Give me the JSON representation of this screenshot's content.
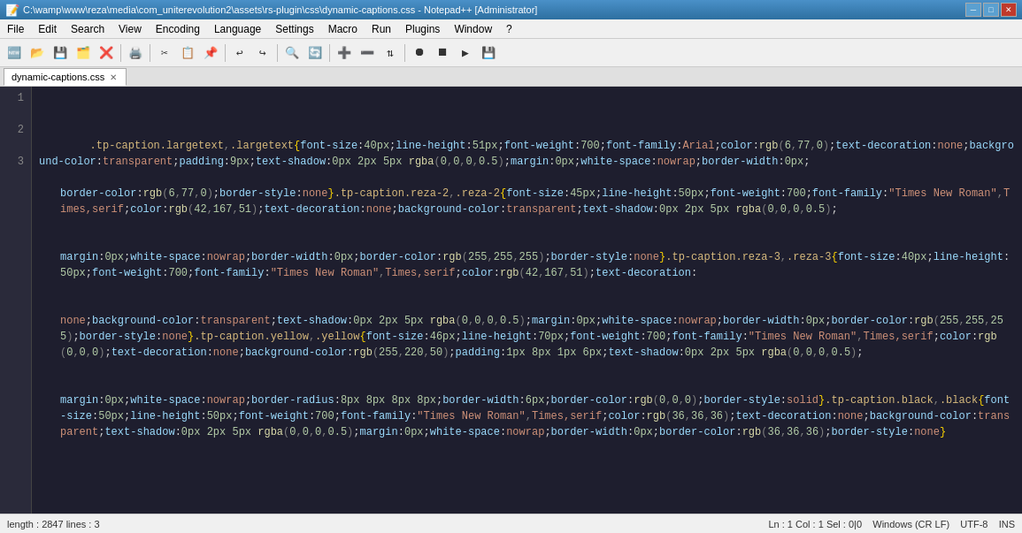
{
  "titleBar": {
    "icon": "📄",
    "title": "C:\\wamp\\www\\reza\\media\\com_uniterevolution2\\assets\\rs-plugin\\css\\dynamic-captions.css - Notepad++ [Administrator]",
    "minimize": "─",
    "maximize": "□",
    "close": "✕"
  },
  "menuBar": {
    "items": [
      "File",
      "Edit",
      "Search",
      "View",
      "Encoding",
      "Language",
      "Settings",
      "Macro",
      "Run",
      "Plugins",
      "Window",
      "?"
    ]
  },
  "tab": {
    "label": "dynamic-captions.css",
    "close": "✕"
  },
  "statusBar": {
    "left": "length: 2847  lines: 3",
    "right": "Ln: 1  Col: 1  Sel: 0|0"
  },
  "lineNumbers": [
    "1",
    "",
    "2",
    "",
    "3"
  ],
  "code": {
    "line1_full": ".tp-caption.largetext,.largetext{font-size:40px;line-height:51px;font-weight:700;font-family:Arial;color:rgb(6,77,0);text-decoration:none;background-color:transparent;padding:9px;text-shadow:0px 2px 5px rgba(0,0,0,0.5);margin:0px;white-space:nowrap;border-width:0px;border-color:rgb(6,77,0);border-style:none}.tp-caption.reza-2,.reza-2{font-size:45px;line-height:50px;font-weight:700;font-family:\"Times New Roman\",Times,serif;color:rgb(42,167,51);text-decoration:none;background-color:transparent;text-shadow:0px 2px 5px rgba(0,0,0,0.5);margin:0px;white-space:nowrap;border-width:0px;border-color:rgb(255,255,255);border-style:none}.tp-caption.reza-3,.reza-3{font-size:40px;line-height:50px;font-weight:700;font-family:\"Times New Roman\",Times,serif;color:rgb(42,167,51);text-decoration:none;background-color:transparent;text-shadow:0px 2px 5px rgba(0,0,0,0.5);margin:0px;white-space:nowrap;border-width:0px;border-color:rgb(255,255,255);border-style:none}.tp-caption.yellow,.yellow{font-size:46px;line-height:70px;font-weight:700;font-family:\"Times New Roman\",Times,serif;color:rgb(0,0,0);text-decoration:none;background-color:rgb(255,220,50);padding:1px 8px 1px 6px;text-shadow:0px 2px 5px rgba(0,0,0,0.5);margin:0px;white-space:nowrap;border-radius:8px 8px 8px 8px;border-width:6px;border-color:rgb(0,0,0);border-style:solid}.tp-caption.black,.black{font-size:50px;line-height:50px;font-weight:700;font-family:\"Times New Roman\",Times,serif;color:rgb(36,36,36);text-decoration:none;background-color:transparent;text-shadow:0px 2px 5px rgba(0,0,0,0.5);margin:0px;white-space:nowrap;border-width:0px;border-color:rgb(36,36,36);border-style:none}"
  }
}
